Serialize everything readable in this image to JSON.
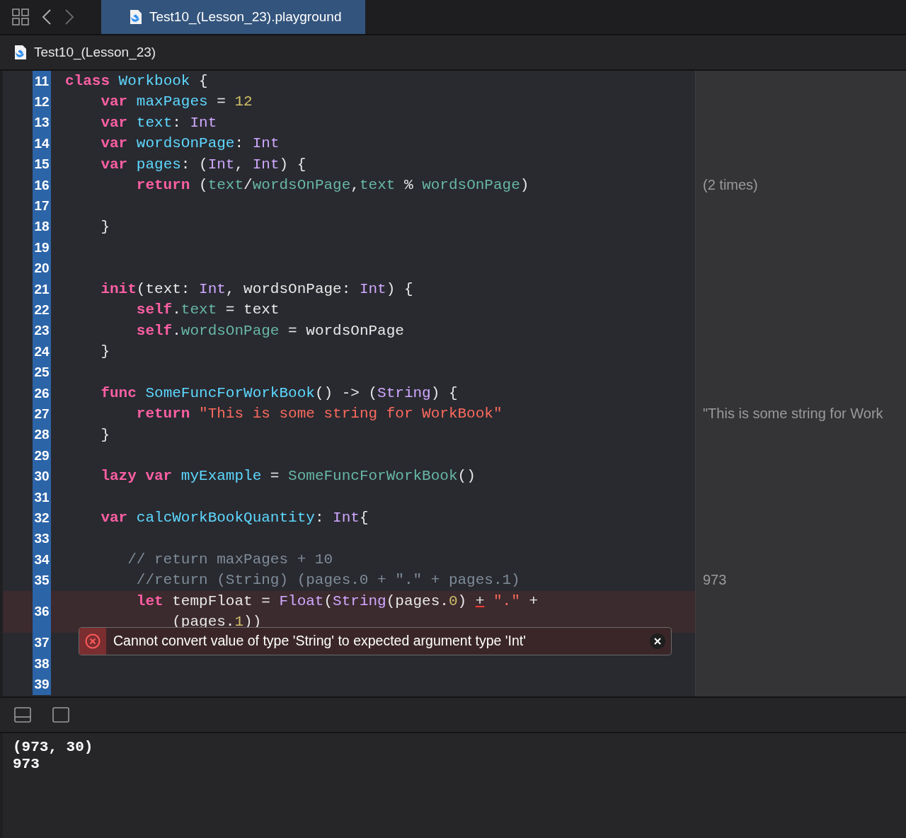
{
  "tab_bar": {
    "tabs": [
      {
        "label": "Test10_(Lesson_23).playground",
        "selected": true
      }
    ]
  },
  "breadcrumb": {
    "label": "Test10_(Lesson_23)"
  },
  "editor": {
    "lines": [
      {
        "number": "11",
        "tokens": [
          {
            "kind": "keyword",
            "text": "class"
          },
          {
            "kind": "decl",
            "text": " Workbook"
          },
          {
            "kind": "plain",
            "text": " {"
          }
        ]
      },
      {
        "number": "12",
        "tokens": [
          {
            "kind": "keyword",
            "text": "    var"
          },
          {
            "kind": "decl",
            "text": " maxPages"
          },
          {
            "kind": "plain",
            "text": " = "
          },
          {
            "kind": "number",
            "text": "12"
          }
        ]
      },
      {
        "number": "13",
        "tokens": [
          {
            "kind": "keyword",
            "text": "    var"
          },
          {
            "kind": "decl",
            "text": " text"
          },
          {
            "kind": "plain",
            "text": ": "
          },
          {
            "kind": "type",
            "text": "Int"
          }
        ]
      },
      {
        "number": "14",
        "tokens": [
          {
            "kind": "keyword",
            "text": "    var"
          },
          {
            "kind": "decl",
            "text": " wordsOnPage"
          },
          {
            "kind": "plain",
            "text": ": "
          },
          {
            "kind": "type",
            "text": "Int"
          }
        ]
      },
      {
        "number": "15",
        "tokens": [
          {
            "kind": "keyword",
            "text": "    var"
          },
          {
            "kind": "decl",
            "text": " pages"
          },
          {
            "kind": "plain",
            "text": ": ("
          },
          {
            "kind": "type",
            "text": "Int"
          },
          {
            "kind": "plain",
            "text": ", "
          },
          {
            "kind": "type",
            "text": "Int"
          },
          {
            "kind": "plain",
            "text": ") {"
          }
        ]
      },
      {
        "number": "16",
        "result": "(2 times)",
        "tokens": [
          {
            "kind": "keyword",
            "text": "        return"
          },
          {
            "kind": "plain",
            "text": " ("
          },
          {
            "kind": "ref",
            "text": "text"
          },
          {
            "kind": "plain",
            "text": "/"
          },
          {
            "kind": "ref",
            "text": "wordsOnPage"
          },
          {
            "kind": "plain",
            "text": ","
          },
          {
            "kind": "ref",
            "text": "text"
          },
          {
            "kind": "plain",
            "text": " % "
          },
          {
            "kind": "ref",
            "text": "wordsOnPage"
          },
          {
            "kind": "plain",
            "text": ")"
          }
        ]
      },
      {
        "number": "17"
      },
      {
        "number": "18",
        "tokens": [
          {
            "kind": "plain",
            "text": "    }"
          }
        ]
      },
      {
        "number": "19"
      },
      {
        "number": "20"
      },
      {
        "number": "21",
        "tokens": [
          {
            "kind": "keyword",
            "text": "    init"
          },
          {
            "kind": "plain",
            "text": "(text: "
          },
          {
            "kind": "type",
            "text": "Int"
          },
          {
            "kind": "plain",
            "text": ", wordsOnPage: "
          },
          {
            "kind": "type",
            "text": "Int"
          },
          {
            "kind": "plain",
            "text": ") {"
          }
        ]
      },
      {
        "number": "22",
        "tokens": [
          {
            "kind": "keyword",
            "text": "        self"
          },
          {
            "kind": "plain",
            "text": "."
          },
          {
            "kind": "ref",
            "text": "text"
          },
          {
            "kind": "plain",
            "text": " = text"
          }
        ]
      },
      {
        "number": "23",
        "tokens": [
          {
            "kind": "keyword",
            "text": "        self"
          },
          {
            "kind": "plain",
            "text": "."
          },
          {
            "kind": "ref",
            "text": "wordsOnPage"
          },
          {
            "kind": "plain",
            "text": " = wordsOnPage"
          }
        ]
      },
      {
        "number": "24",
        "tokens": [
          {
            "kind": "plain",
            "text": "    }"
          }
        ]
      },
      {
        "number": "25"
      },
      {
        "number": "26",
        "tokens": [
          {
            "kind": "keyword",
            "text": "    func"
          },
          {
            "kind": "decl",
            "text": " SomeFuncForWorkBook"
          },
          {
            "kind": "plain",
            "text": "() -> ("
          },
          {
            "kind": "type",
            "text": "String"
          },
          {
            "kind": "plain",
            "text": ") {"
          }
        ]
      },
      {
        "number": "27",
        "result": "\"This is some string for Work",
        "tokens": [
          {
            "kind": "keyword",
            "text": "        return"
          },
          {
            "kind": "string",
            "text": " \"This is some string for WorkBook\""
          }
        ]
      },
      {
        "number": "28",
        "tokens": [
          {
            "kind": "plain",
            "text": "    }"
          }
        ]
      },
      {
        "number": "29"
      },
      {
        "number": "30",
        "tokens": [
          {
            "kind": "keyword",
            "text": "    lazy var"
          },
          {
            "kind": "decl",
            "text": " myExample"
          },
          {
            "kind": "plain",
            "text": " = "
          },
          {
            "kind": "ref",
            "text": "SomeFuncForWorkBook"
          },
          {
            "kind": "plain",
            "text": "()"
          }
        ]
      },
      {
        "number": "31"
      },
      {
        "number": "32",
        "tokens": [
          {
            "kind": "keyword",
            "text": "    var"
          },
          {
            "kind": "decl",
            "text": " calcWorkBookQuantity"
          },
          {
            "kind": "plain",
            "text": ": "
          },
          {
            "kind": "type",
            "text": "Int"
          },
          {
            "kind": "plain",
            "text": "{"
          }
        ]
      },
      {
        "number": "33"
      },
      {
        "number": "34",
        "tokens": [
          {
            "kind": "comment",
            "text": "       // return maxPages + 10"
          }
        ]
      },
      {
        "number": "35",
        "result": "973",
        "tokens": [
          {
            "kind": "comment",
            "text": "        //return (String) (pages.0 + \".\" + pages.1)"
          }
        ]
      },
      {
        "number": "36",
        "error": true,
        "tokens": [
          {
            "kind": "keyword",
            "text": "        let"
          },
          {
            "kind": "plain",
            "text": " tempFloat = "
          },
          {
            "kind": "type",
            "text": "Float"
          },
          {
            "kind": "plain",
            "text": "("
          },
          {
            "kind": "type",
            "text": "String"
          },
          {
            "kind": "plain",
            "text": "(pages."
          },
          {
            "kind": "number",
            "text": "0"
          },
          {
            "kind": "plain",
            "text": ") "
          },
          {
            "kind": "error",
            "text": "+"
          },
          {
            "kind": "string",
            "text": " \".\""
          },
          {
            "kind": "plain",
            "text": " +"
          }
        ],
        "continuation": [
          {
            "kind": "plain",
            "text": "            (pages."
          },
          {
            "kind": "number",
            "text": "1"
          },
          {
            "kind": "plain",
            "text": "))"
          }
        ]
      },
      {
        "number": "37",
        "banner": {
          "message": "Cannot convert value of type 'String' to expected argument type 'Int'"
        }
      },
      {
        "number": "38"
      },
      {
        "number": "39"
      }
    ]
  },
  "console": {
    "lines": [
      "(973, 30)",
      "973"
    ]
  }
}
